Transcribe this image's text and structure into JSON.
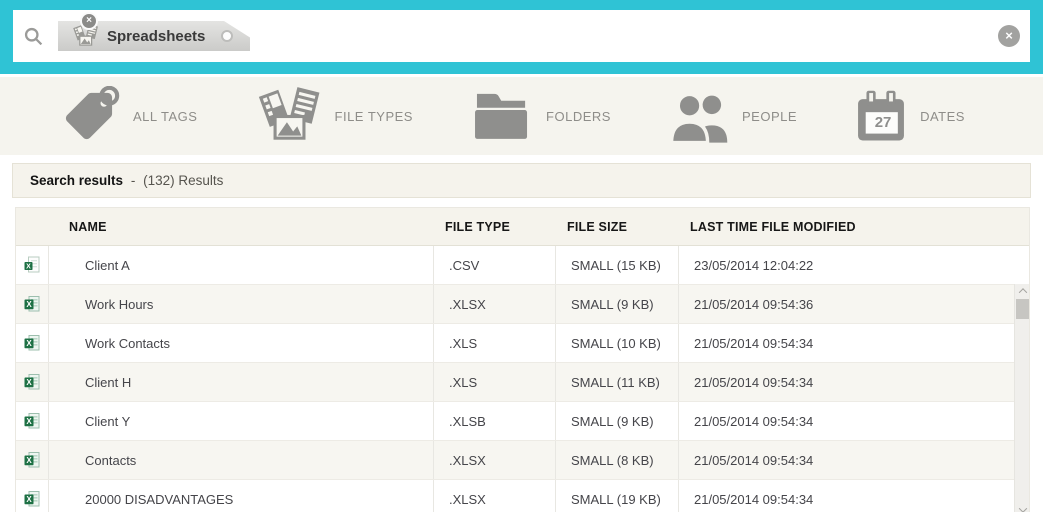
{
  "colors": {
    "accent_teal": "#2fc3d5",
    "panel_beige": "#f5f3ec",
    "icon_gray": "#8f8f8d",
    "excel_green": "#1e7145"
  },
  "search_bar": {
    "chip": {
      "label": "Spreadsheets",
      "icon": "file-types-icon",
      "remove_label": "×"
    },
    "clear_label": "×"
  },
  "filters": [
    {
      "label": "ALL TAGS",
      "icon": "tag-icon"
    },
    {
      "label": "FILE TYPES",
      "icon": "file-types-icon"
    },
    {
      "label": "FOLDERS",
      "icon": "folder-icon"
    },
    {
      "label": "PEOPLE",
      "icon": "people-icon"
    },
    {
      "label": "DATES",
      "icon": "calendar-icon",
      "calendar_day": "27"
    }
  ],
  "results_bar": {
    "title": "Search results",
    "separator": "-",
    "count": "(132) Results"
  },
  "table": {
    "columns": [
      "NAME",
      "FILE TYPE",
      "FILE SIZE",
      "LAST TIME FILE MODIFIED"
    ],
    "rows": [
      {
        "icon": "csv-file-icon",
        "name": "Client A",
        "file_type": ".CSV",
        "file_size": "SMALL (15 KB)",
        "modified": "23/05/2014 12:04:22"
      },
      {
        "icon": "excel-file-icon",
        "name": "Work Hours",
        "file_type": ".XLSX",
        "file_size": "SMALL (9 KB)",
        "modified": "21/05/2014 09:54:36"
      },
      {
        "icon": "excel-file-icon",
        "name": "Work Contacts",
        "file_type": ".XLS",
        "file_size": "SMALL (10 KB)",
        "modified": "21/05/2014 09:54:34"
      },
      {
        "icon": "excel-file-icon",
        "name": "Client H",
        "file_type": ".XLS",
        "file_size": "SMALL (11 KB)",
        "modified": "21/05/2014 09:54:34"
      },
      {
        "icon": "excel-file-icon",
        "name": "Client Y",
        "file_type": ".XLSB",
        "file_size": "SMALL (9 KB)",
        "modified": "21/05/2014 09:54:34"
      },
      {
        "icon": "excel-file-icon",
        "name": "Contacts",
        "file_type": ".XLSX",
        "file_size": "SMALL (8 KB)",
        "modified": "21/05/2014 09:54:34"
      },
      {
        "icon": "excel-file-icon",
        "name": "20000 DISADVANTAGES",
        "file_type": ".XLSX",
        "file_size": "SMALL (19 KB)",
        "modified": "21/05/2014 09:54:34"
      }
    ]
  }
}
